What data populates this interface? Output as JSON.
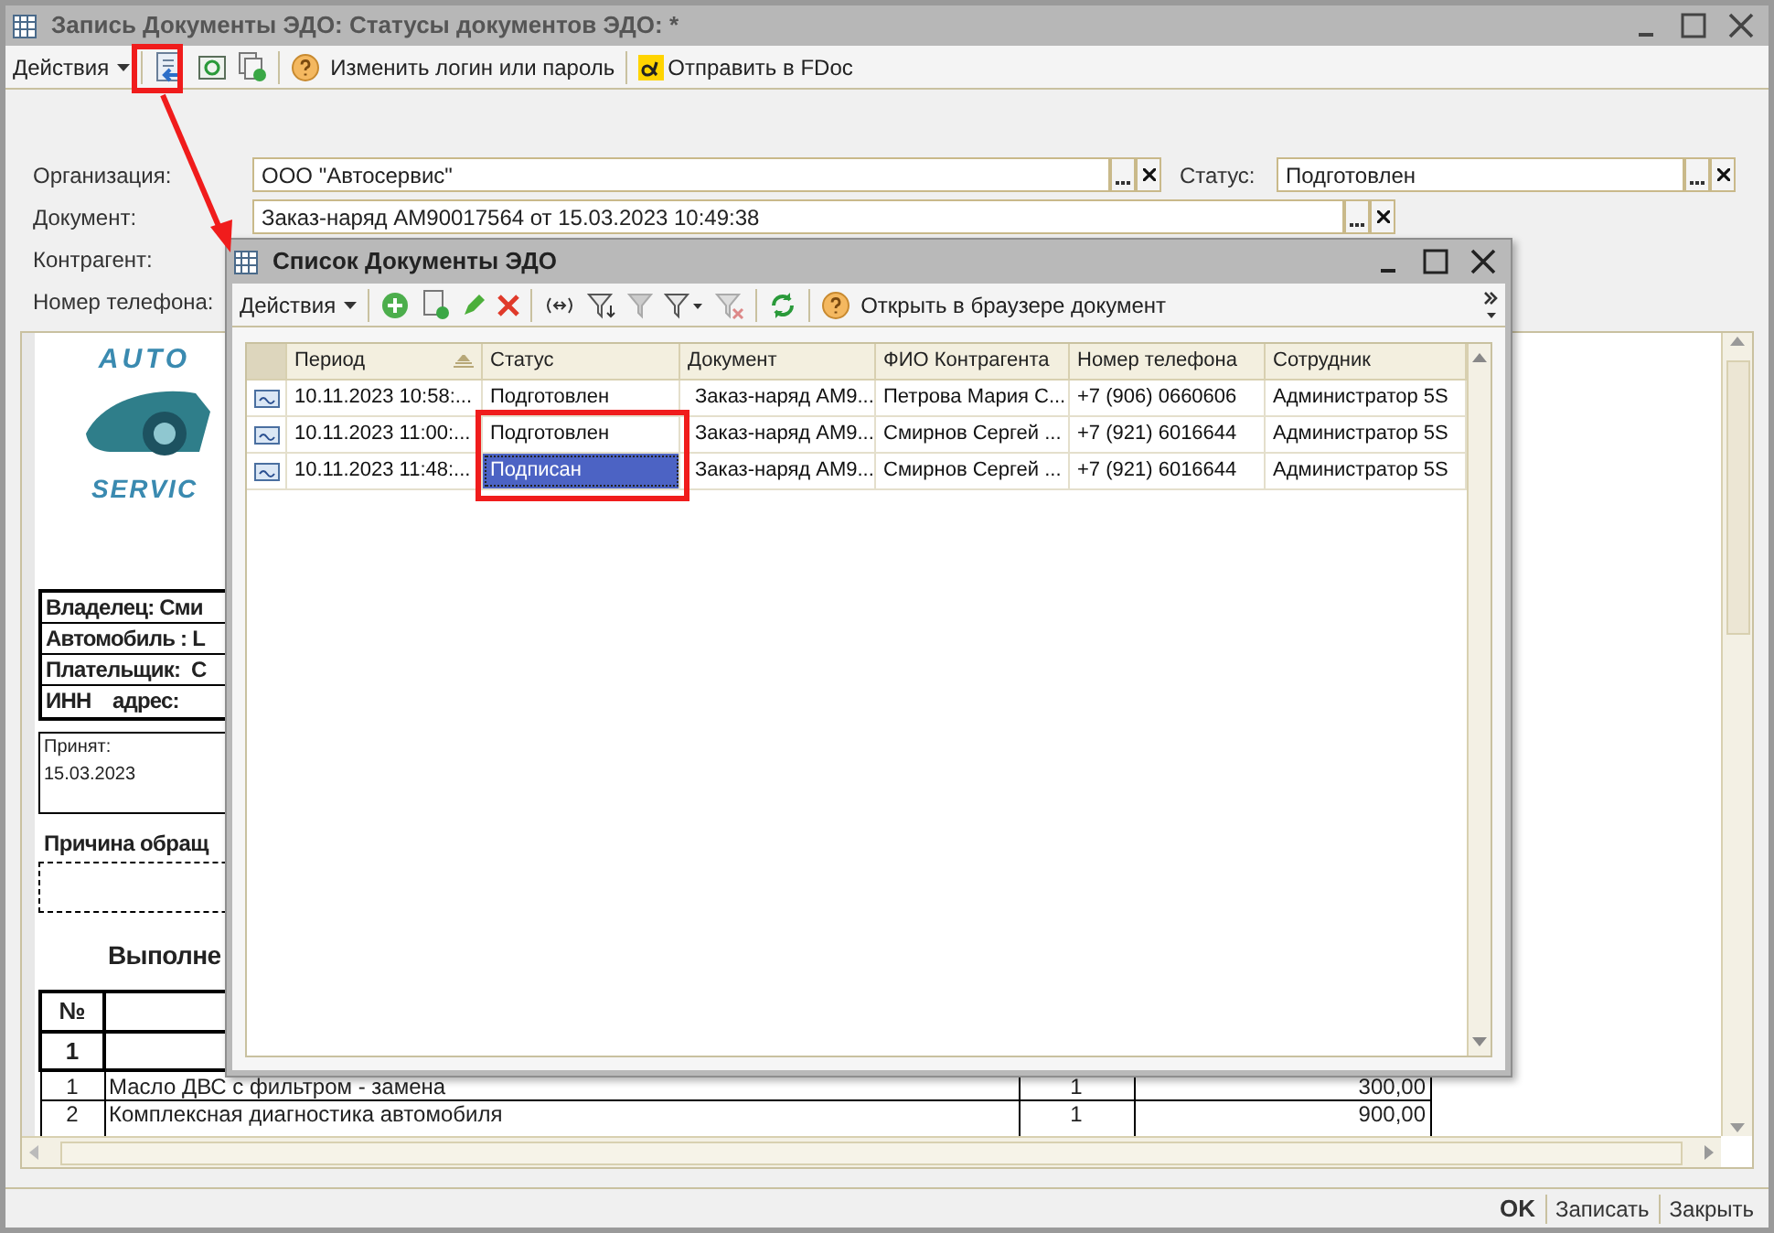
{
  "window": {
    "title": "Запись Документы ЭДО: Статусы документов ЭДО:  *"
  },
  "toolbar": {
    "actions_menu": "Действия",
    "change_login": "Изменить логин или пароль",
    "send_fdoc": "Отправить в FDoc"
  },
  "form": {
    "fields": [
      {
        "label": "Организация:",
        "value": "ООО \"Автосервис\""
      },
      {
        "label": "Статус:",
        "value": "Подготовлен"
      },
      {
        "label": "Документ:",
        "value": "Заказ-наряд АМ90017564 от 15.03.2023 10:49:38"
      },
      {
        "label": "Контрагент:"
      },
      {
        "label": "Номер телефона:"
      }
    ]
  },
  "preview": {
    "logo_top": "AUTO",
    "logo_bottom": "SERVIC",
    "info_rows": [
      "Владелец: Сми",
      "Автомобиль : L",
      "Плательщик:  С",
      "ИНН    адрес:"
    ],
    "accepted_label": "Принят:",
    "accepted_date": "15.03.2023",
    "reason_heading": "Причина обращ",
    "works_heading": "Выполне",
    "table": {
      "number_heading": "№",
      "group": "1",
      "rows": [
        {
          "no": "1",
          "name": "Масло ДВС с фильтром - замена",
          "qty": "1",
          "amount": "300,00"
        },
        {
          "no": "2",
          "name": "Комплексная диагностика автомобиля",
          "qty": "1",
          "amount": "900,00"
        }
      ]
    }
  },
  "list_window": {
    "title": "Список Документы ЭДО",
    "actions_menu": "Действия",
    "open_in_browser": "Открыть в браузере документ",
    "columns": [
      "Период",
      "Статус",
      "Документ",
      "ФИО Контрагента",
      "Номер телефона",
      "Сотрудник"
    ],
    "rows": [
      {
        "selected": false,
        "cells": [
          "10.11.2023 10:58:...",
          "Подготовлен",
          "Заказ-наряд АМ9...",
          "Петрова Мария С...",
          "+7 (906) 0660606",
          "Администратор 5S"
        ]
      },
      {
        "selected": false,
        "cells": [
          "10.11.2023 11:00:...",
          "Подготовлен",
          "Заказ-наряд АМ9...",
          "Смирнов Сергей ...",
          "+7 (921) 6016644",
          "Администратор 5S"
        ]
      },
      {
        "selected": true,
        "cells": [
          "10.11.2023 11:48:...",
          "Подписан",
          "Заказ-наряд АМ9...",
          "Смирнов Сергей ...",
          "+7 (921) 6016644",
          "Администратор 5S"
        ]
      }
    ]
  },
  "footer_buttons": [
    "OK",
    "Записать",
    "Закрыть"
  ]
}
